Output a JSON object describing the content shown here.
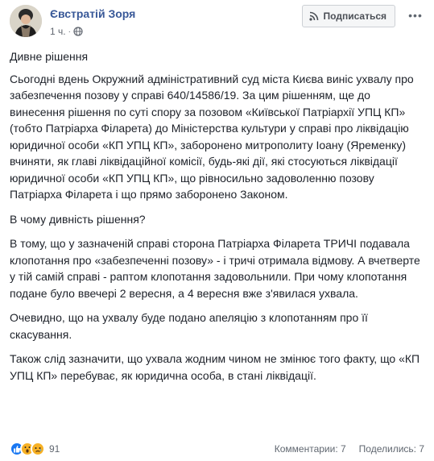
{
  "post": {
    "author": "Євстратій Зоря",
    "time": "1 ч.",
    "subscribe_label": "Подписаться",
    "more_label": "•••"
  },
  "content": {
    "title": "Дивне рішення",
    "paragraphs": [
      "Сьогодні вдень Окружний адміністративний суд міста Києва виніс ухвалу про забезпечення позову у справі 640/14586/19. За цим рішенням, ще до винесення рішення по суті спору за позовом «Київської Патріархії УПЦ КП» (тобто Патріарха Філарета) до Міністерства культури у справі про ліквідацію юридичної особи «КП УПЦ КП», заборонено митрополиту Іоану (Яременку) вчиняти, як главі ліквідаційної комісії, будь-які дії, які стосуються ліквідації юридичної особи «КП УПЦ КП», що рівносильно задоволенню позову Патріарха Філарета і що прямо заборонено Законом.",
      "В чому дивність рішення?",
      "В тому, що у зазначеній справі сторона Патріарха Філарета ТРИЧІ подавала клопотання про «забезпеченні позову» - і тричі отримала відмову. А вчетверте у тій самій справі - раптом клопотання задовольнили. При чому клопотання подане було ввечері 2 вересня, а 4 вересня вже з'явилася ухвала.",
      "Очевидно, що на ухвалу буде подано апеляцію з клопотанням про її скасування.",
      "Також слід зазначити, що ухвала жодним чином не змінює того факту, що «КП УПЦ КП» перебуває, як юридична особа, в стані ліквідації."
    ]
  },
  "footer": {
    "reaction_icons": [
      "like-icon",
      "wow-icon",
      "sad-icon"
    ],
    "reactions_count": "91",
    "comments": "Комментарии: 7",
    "shares": "Поделились: 7"
  },
  "colors": {
    "author": "#385898",
    "like": "#1877f2",
    "emoji": "#f7b125"
  }
}
